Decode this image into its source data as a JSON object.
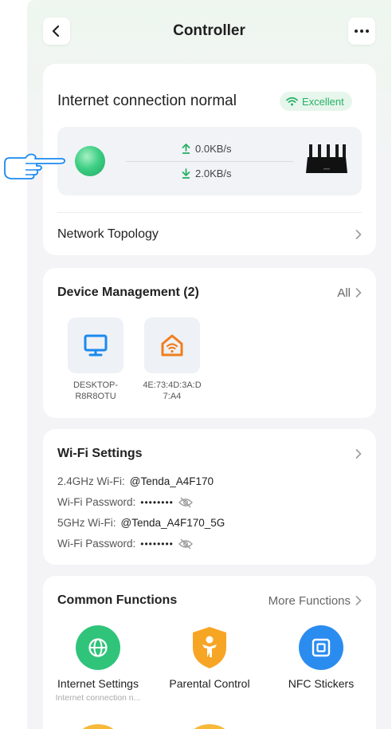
{
  "header": {
    "title": "Controller",
    "back_icon": "chevron-left-icon",
    "more_icon": "ellipsis-icon"
  },
  "status": {
    "title": "Internet connection normal",
    "badge": "Excellent",
    "upload": "0.0KB/s",
    "download": "2.0KB/s",
    "topology_label": "Network Topology"
  },
  "devices": {
    "title": "Device Management (2)",
    "all_label": "All",
    "items": [
      {
        "name": "DESKTOP-\nR8R8OTU",
        "icon": "monitor-icon"
      },
      {
        "name": "4E:73:4D:3A:D\n7:A4",
        "icon": "smart-home-icon"
      }
    ]
  },
  "wifi": {
    "title": "Wi-Fi Settings",
    "lines": [
      {
        "label": "2.4GHz Wi-Fi:",
        "value": "@Tenda_A4F170"
      },
      {
        "label": "Wi-Fi Password:",
        "value": "••••••••"
      },
      {
        "label": "5GHz Wi-Fi:",
        "value": "@Tenda_A4F170_5G"
      },
      {
        "label": "Wi-Fi Password:",
        "value": "••••••••"
      }
    ]
  },
  "functions": {
    "title": "Common Functions",
    "more_label": "More Functions",
    "items": [
      {
        "label": "Internet Settings",
        "sub": "Internet connection n...",
        "color": "#2fc47a",
        "icon": "globe-icon"
      },
      {
        "label": "Parental Control",
        "sub": "",
        "color": "#f7a524",
        "icon": "child-shield-icon"
      },
      {
        "label": "NFC Stickers",
        "sub": "",
        "color": "#2b8cf0",
        "icon": "nfc-icon"
      }
    ]
  },
  "colors": {
    "accent_green": "#27b066",
    "background": "#f4f4f6"
  }
}
